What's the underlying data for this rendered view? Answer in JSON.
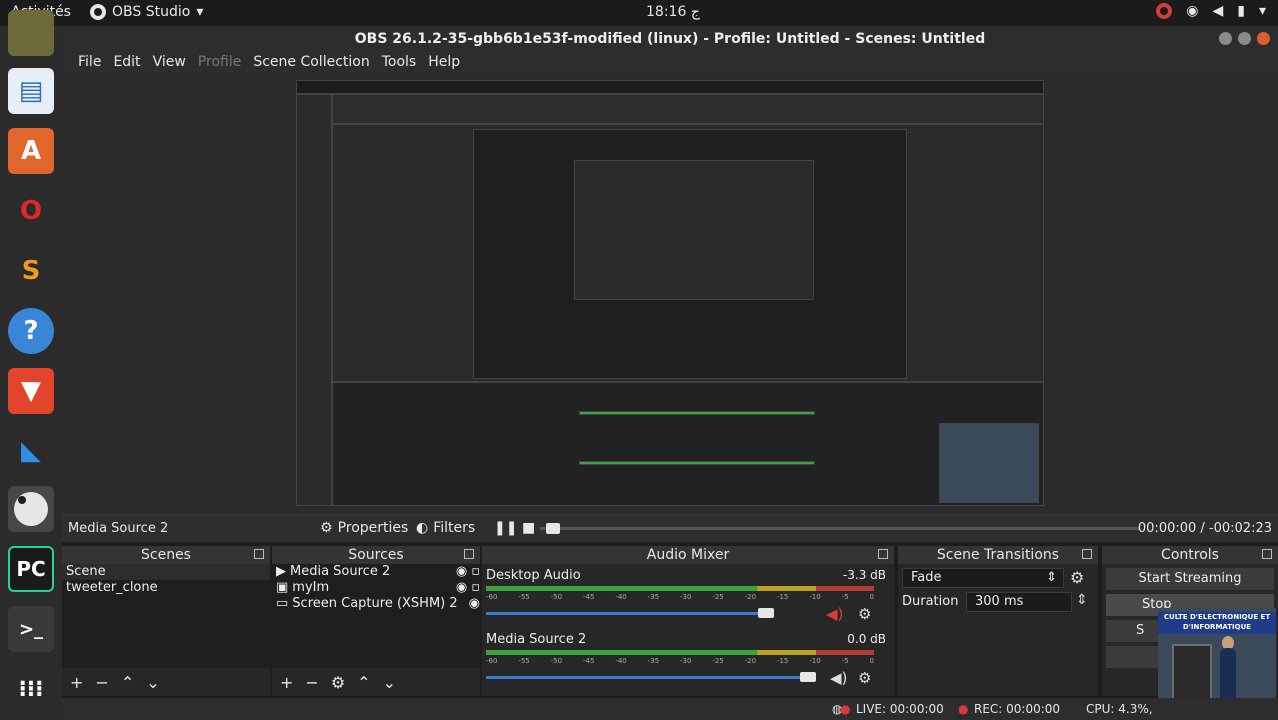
{
  "topbar": {
    "activities": "Activités",
    "app_name": "OBS Studio",
    "app_arrow": "▾",
    "clock": "18:16",
    "clock_suffix": "ج"
  },
  "window": {
    "title": "OBS 26.1.2-35-gbb6b1e53f-modified (linux) - Profile: Untitled - Scenes: Untitled"
  },
  "menu": {
    "file": "File",
    "edit": "Edit",
    "view": "View",
    "profile": "Profile",
    "scene_collection": "Scene Collection",
    "tools": "Tools",
    "help": "Help"
  },
  "source_bar": {
    "name": "Media Source 2",
    "properties": "Properties",
    "filters": "Filters",
    "time": "00:00:00 / -00:02:23"
  },
  "scenes": {
    "title": "Scenes",
    "items": [
      "Scene",
      "tweeter_clone"
    ]
  },
  "sources": {
    "title": "Sources",
    "items": [
      {
        "icon": "▶",
        "label": "Media Source 2"
      },
      {
        "icon": "▣",
        "label": "myIm"
      },
      {
        "icon": "▭",
        "label": "Screen Capture (XSHM) 2"
      }
    ]
  },
  "mixer": {
    "title": "Audio Mixer",
    "channels": [
      {
        "name": "Desktop Audio",
        "db": "-3.3 dB"
      },
      {
        "name": "Media Source 2",
        "db": "0.0 dB"
      }
    ],
    "ticks": [
      "-60",
      "-55",
      "-50",
      "-45",
      "-40",
      "-35",
      "-30",
      "-25",
      "-20",
      "-15",
      "-10",
      "-5",
      "0"
    ]
  },
  "transitions": {
    "title": "Scene Transitions",
    "type": "Fade",
    "duration_label": "Duration",
    "duration_value": "300 ms"
  },
  "controls": {
    "title": "Controls",
    "start_streaming": "Start Streaming",
    "stop": "Stop",
    "s": "S"
  },
  "webcam": {
    "banner": "CULTE D'ELECTRONIQUE ET D'INFORMATIQUE"
  },
  "status": {
    "live": "LIVE: 00:00:00",
    "rec": "REC: 00:00:00",
    "cpu": "CPU: 4.3%,"
  },
  "colors": {
    "accent_red": "#d93b3b",
    "volume_blue": "#3c7ad1"
  }
}
